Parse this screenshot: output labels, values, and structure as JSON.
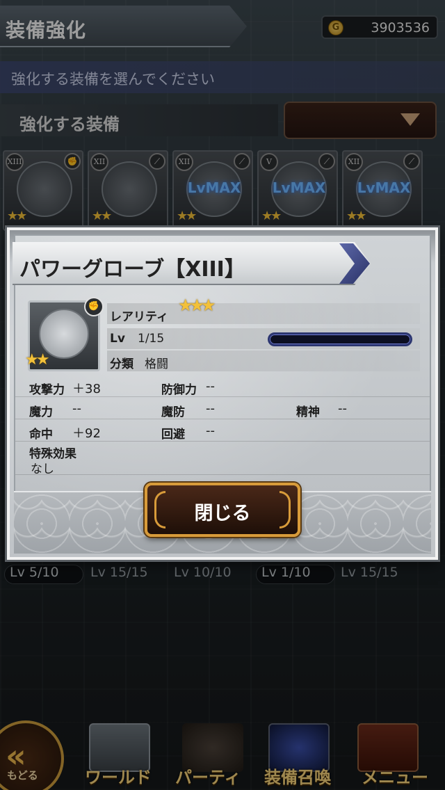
{
  "header": {
    "title": "装備強化",
    "gil": "3903536",
    "gil_icon": "gil-coin-icon"
  },
  "instruction": "強化する装備を選んでください",
  "section": {
    "label": "強化する装備",
    "dropdown_icon": "chevron-down-icon"
  },
  "equipment_list": {
    "cards": [
      {
        "rank": "XIII",
        "lvmax": "",
        "stars": "★★"
      },
      {
        "rank": "XII",
        "lvmax": "",
        "stars": "★★"
      },
      {
        "rank": "XII",
        "lvmax": "LvMAX",
        "stars": "★★"
      },
      {
        "rank": "V",
        "lvmax": "LvMAX",
        "stars": "★★"
      },
      {
        "rank": "XII",
        "lvmax": "LvMAX",
        "stars": "★★"
      }
    ],
    "levels": [
      "Lv 5/10",
      "Lv 15/15",
      "Lv 10/10",
      "Lv 1/10",
      "Lv 15/15"
    ]
  },
  "modal": {
    "item_name": "パワーグローブ【XIII】",
    "rarity_label": "レアリティ",
    "rarity_stars": "★★★",
    "lv_label": "Lv",
    "lv_value": "1/15",
    "lv_progress": 0.0,
    "category_label": "分類",
    "category_value": "格闘",
    "icon_stars": "★★",
    "stats": {
      "attack_label": "攻撃力",
      "attack_value": "＋38",
      "defense_label": "防御力",
      "defense_value": "--",
      "magic_label": "魔力",
      "magic_value": "--",
      "mdef_label": "魔防",
      "mdef_value": "--",
      "spirit_label": "精神",
      "spirit_value": "--",
      "accuracy_label": "命中",
      "accuracy_value": "＋92",
      "evasion_label": "回避",
      "evasion_value": "--"
    },
    "special_label": "特殊効果",
    "special_value": "なし",
    "close_label": "閉じる"
  },
  "nav": {
    "back_label": "もどる",
    "world_label": "ワールド",
    "party_label": "パーティ",
    "summon_label": "装備召喚",
    "menu_label": "メニュー"
  },
  "colors": {
    "accent_gold": "#d89b3a",
    "lvmax_blue": "#6fb7ff",
    "star": "#f3c13a"
  }
}
